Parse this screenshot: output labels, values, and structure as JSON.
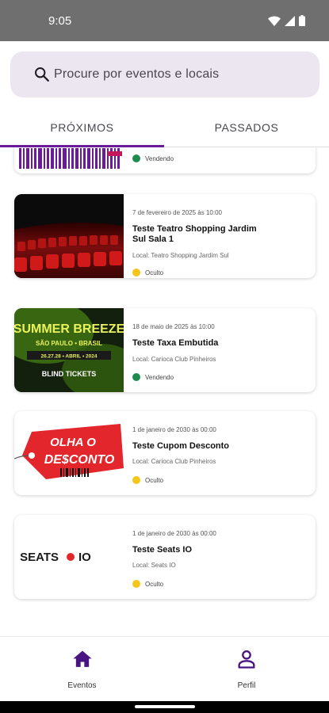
{
  "status_bar": {
    "time": "9:05"
  },
  "search": {
    "placeholder": "Procure por eventos e locais"
  },
  "tabs": [
    {
      "label": "PRÓXIMOS",
      "selected": true
    },
    {
      "label": "PASSADOS",
      "selected": false
    }
  ],
  "partial_event": {
    "status": "Vendendo",
    "status_color": "#1e8c4e"
  },
  "events": [
    {
      "date": "7 de fevereiro de 2025 às 10:00",
      "title": "Teste Teatro Shopping Jardim Sul Sala 1",
      "location": "Local: Teatro Shopping Jardim Sul",
      "status": "Oculto",
      "status_color": "#f5c518",
      "image": "theater-seats-image"
    },
    {
      "date": "18 de maio de 2025 às 10:00",
      "title": "Teste Taxa Embutida",
      "location": "Local: Carioca Club Pinheiros",
      "status": "Vendendo",
      "status_color": "#1e8c4e",
      "image": "summer-breeze-banner",
      "image_text": {
        "title": "SUMMER BREEZE",
        "subtitle": "SÃO PAULO • BRASIL",
        "dates": "26.27.28 • ABRIL • 2024",
        "badge": "BLIND TICKETS"
      }
    },
    {
      "date": "1 de janeiro de 2030 às 00:00",
      "title": "Teste Cupom Desconto",
      "location": "Local: Carioca Club Pinheiros",
      "status": "Oculto",
      "status_color": "#f5c518",
      "image": "olha-o-desconto-tag",
      "image_text": {
        "line1": "OLHA O",
        "line2": "DE$CONTO"
      }
    },
    {
      "date": "1 de janeiro de 2030 às 00:00",
      "title": "Teste Seats IO",
      "location": "Local: Seats IO",
      "status": "Oculto",
      "status_color": "#f5c518",
      "image": "seats-io-logo",
      "image_text": {
        "left": "SEATS",
        "right": "IO"
      }
    }
  ],
  "bottom_nav": [
    {
      "label": "Eventos",
      "icon": "home-icon",
      "selected": true
    },
    {
      "label": "Perfil",
      "icon": "person-icon",
      "selected": false
    }
  ],
  "colors": {
    "accent": "#6a1b9a",
    "search_bg": "#ece6f0",
    "status_bar": "#6f6f6f"
  }
}
